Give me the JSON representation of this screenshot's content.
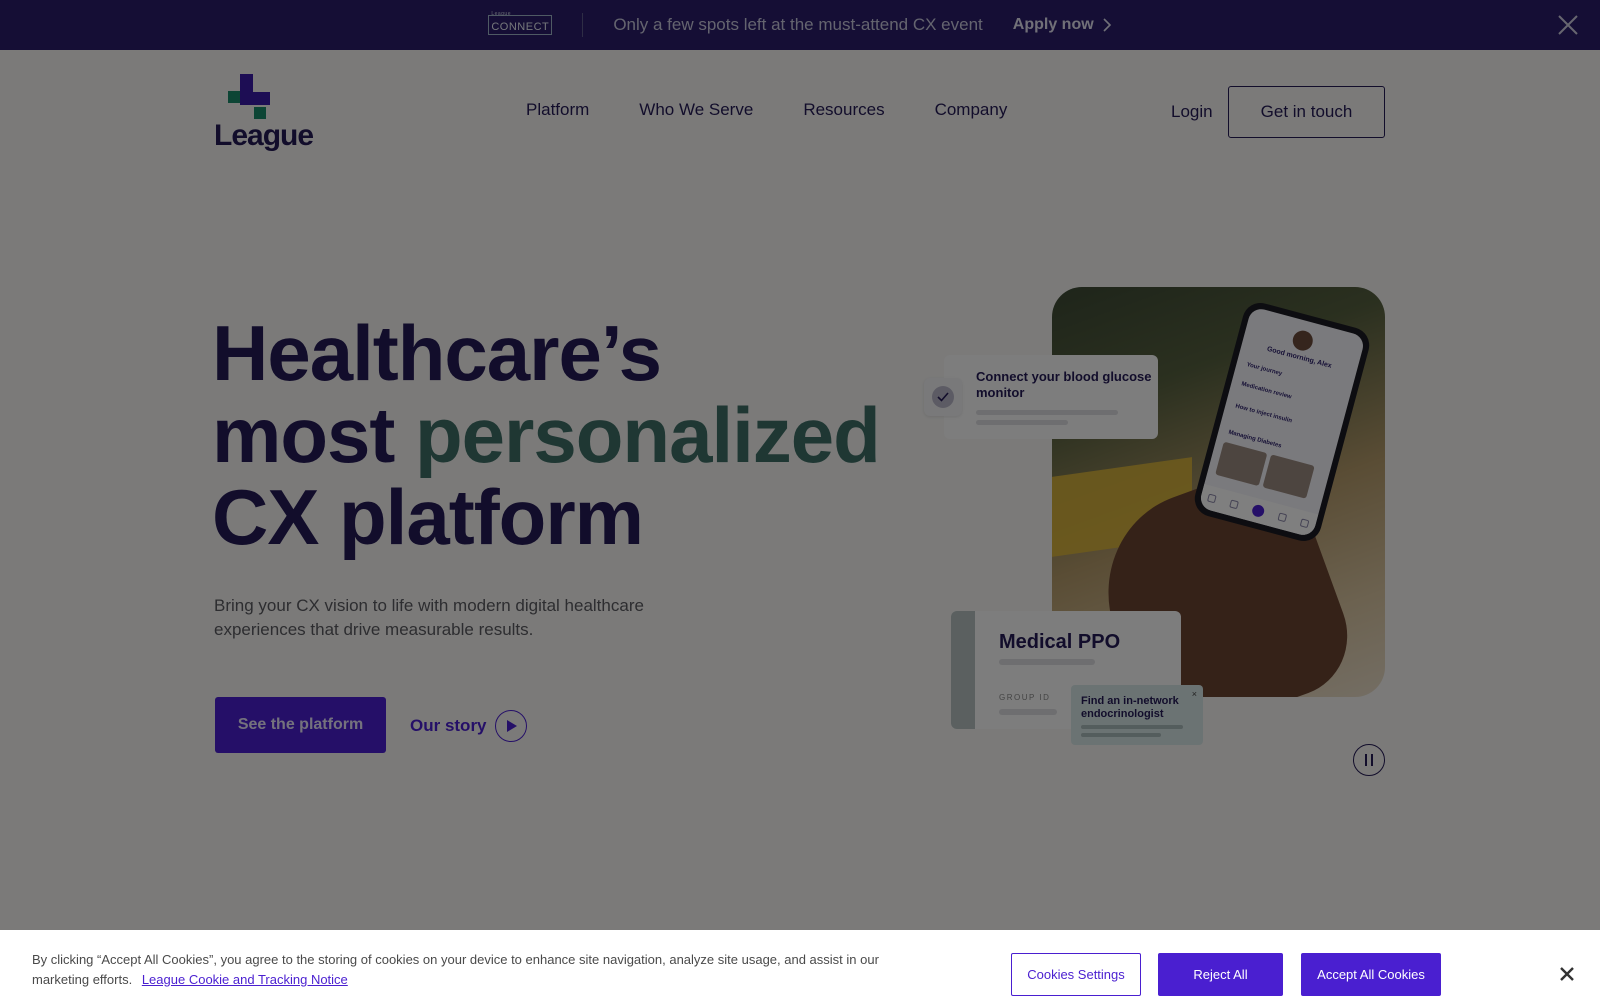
{
  "announcement": {
    "logo_small": "League",
    "logo_main": "CONNECT",
    "text": "Only a few spots left at the must-attend CX event",
    "cta_label": "Apply now"
  },
  "header": {
    "logo_text": "League",
    "nav": [
      "Platform",
      "Who We Serve",
      "Resources",
      "Company"
    ],
    "login_label": "Login",
    "contact_label": "Get in touch"
  },
  "hero": {
    "headline_line1": "Healthcare’s",
    "headline_line2_a": "most",
    "headline_line2_accent": "personalized",
    "headline_line3": "CX platform",
    "subtitle": "Bring your CX vision to life with modern digital healthcare experiences that drive measurable results.",
    "primary_cta": "See the platform",
    "secondary_cta": "Our story"
  },
  "visual": {
    "glucose_card_title": "Connect your blood glucose monitor",
    "ppo_card_title": "Medical PPO",
    "ppo_card_label": "GROUP ID",
    "find_card_title": "Find an in-network endocrinologist",
    "find_card_close": "×",
    "phone": {
      "greeting": "Good morning, Alex",
      "section1": "Your journey",
      "item1": "Medication review",
      "item2": "How to inject insulin",
      "section2": "Managing Diabetes"
    }
  },
  "cookie_banner": {
    "text": "By clicking “Accept All Cookies”, you agree to the storing of cookies on your device to enhance site navigation, analyze site usage, and assist in our marketing efforts.",
    "link_text": "League Cookie and Tracking Notice",
    "settings_label": "Cookies Settings",
    "reject_label": "Reject All",
    "accept_label": "Accept All Cookies"
  },
  "colors": {
    "brand_purple": "#4a1fd0",
    "navy": "#241a56",
    "accent_green": "#3f6e66",
    "announcement_bg": "#2a1d6a"
  }
}
